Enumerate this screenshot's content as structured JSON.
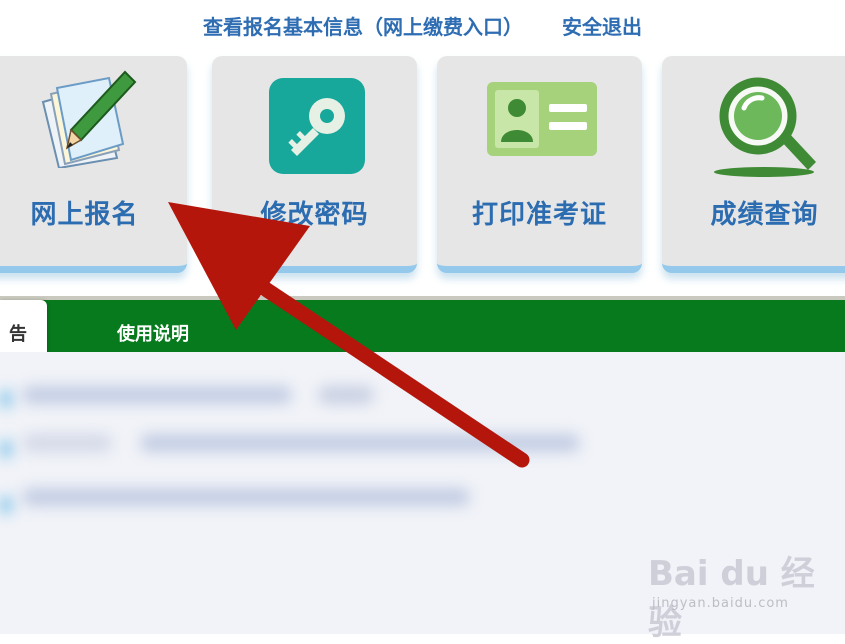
{
  "header": {
    "info_link": "查看报名基本信息（网上缴费入口）",
    "logout_link": "安全退出"
  },
  "tiles": [
    {
      "label": "网上报名",
      "icon": "register-pencil-icon"
    },
    {
      "label": "修改密码",
      "icon": "key-icon"
    },
    {
      "label": "打印准考证",
      "icon": "id-card-icon"
    },
    {
      "label": "成绩查询",
      "icon": "magnifier-icon"
    }
  ],
  "tabs": {
    "active_partial": "告",
    "usage": "使用说明"
  },
  "watermark": {
    "logo": "Bai du 经验",
    "url": "jingyan.baidu.com"
  },
  "colors": {
    "link_blue": "#2f6db3",
    "tab_green": "#067a1c",
    "arrow_red": "#b4160c",
    "tile_bg": "#e6e6e6",
    "tile_border": "#94c9ec"
  }
}
